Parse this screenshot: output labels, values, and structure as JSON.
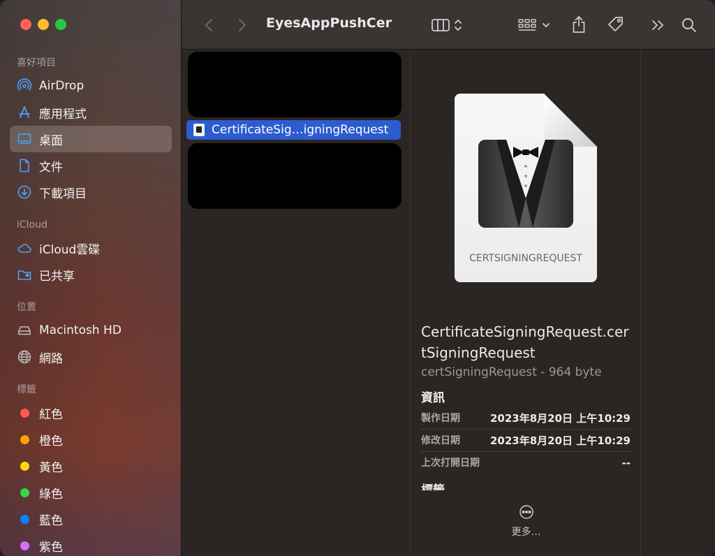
{
  "window": {
    "title": "EyesAppPushCer"
  },
  "sidebar": {
    "favorites_header": "喜好項目",
    "favorites": [
      {
        "label": "AirDrop",
        "icon": "airdrop-icon"
      },
      {
        "label": "應用程式",
        "icon": "applications-icon"
      },
      {
        "label": "桌面",
        "icon": "desktop-icon",
        "active": true
      },
      {
        "label": "文件",
        "icon": "document-icon"
      },
      {
        "label": "下載項目",
        "icon": "download-icon"
      }
    ],
    "icloud_header": "iCloud",
    "icloud": [
      {
        "label": "iCloud雲碟",
        "icon": "cloud-icon"
      },
      {
        "label": "已共享",
        "icon": "shared-folder-icon"
      }
    ],
    "locations_header": "位置",
    "locations": [
      {
        "label": "Macintosh HD",
        "icon": "disk-icon"
      },
      {
        "label": "網路",
        "icon": "globe-icon"
      }
    ],
    "tags_header": "標籤",
    "tags": [
      {
        "label": "紅色",
        "color": "#ff5a52"
      },
      {
        "label": "橙色",
        "color": "#ff9f0a"
      },
      {
        "label": "黃色",
        "color": "#ffd60a"
      },
      {
        "label": "綠色",
        "color": "#32d74b"
      },
      {
        "label": "藍色",
        "color": "#0a84ff"
      },
      {
        "label": "紫色",
        "color": "#d66efd"
      }
    ]
  },
  "file_list": {
    "selected_file": "CertificateSig…igningRequest"
  },
  "preview": {
    "icon_label": "CERTSIGNINGREQUEST",
    "file_name": "CertificateSigningRequest.certSigningRequest",
    "kind_size": "certSigningRequest - 964 byte",
    "info_header": "資訊",
    "rows": [
      {
        "key": "製作日期",
        "value": "2023年8月20日 上午10:29"
      },
      {
        "key": "修改日期",
        "value": "2023年8月20日 上午10:29"
      },
      {
        "key": "上次打開日期",
        "value": "--"
      }
    ],
    "tags_header": "標籤",
    "more_label": "更多…"
  },
  "colors": {
    "selection": "#2c5ccf",
    "sidebar_active": "rgba(255,255,255,0.18)"
  }
}
